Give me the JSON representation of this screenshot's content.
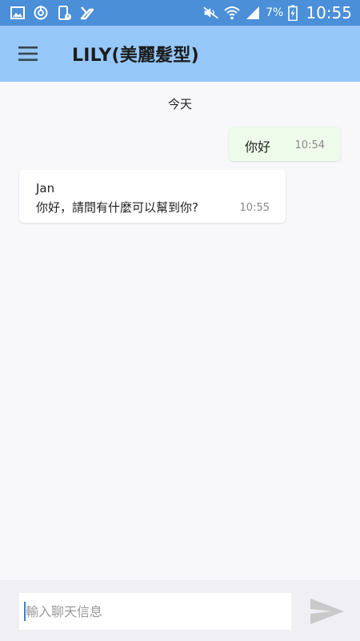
{
  "status_bar": {
    "battery": "7%",
    "time": "10:55",
    "icons": [
      "gallery-icon",
      "sync-icon",
      "device-alert-icon",
      "checkmark-app-icon",
      "mute-icon",
      "wifi-icon",
      "signal-icon",
      "battery-charging-icon"
    ]
  },
  "app_bar": {
    "menu_icon": "hamburger-menu-icon",
    "title": "LILY(美麗髮型)"
  },
  "chat": {
    "date_divider": "今天",
    "messages": [
      {
        "direction": "outgoing",
        "text": "你好",
        "time": "10:54"
      },
      {
        "direction": "incoming",
        "sender": "Jan",
        "text": "你好，請問有什麼可以幫到你?",
        "time": "10:55"
      }
    ]
  },
  "input": {
    "placeholder": "輸入聊天信息",
    "value": "",
    "send_icon": "send-icon"
  },
  "colors": {
    "status_bar": "#4a8fd8",
    "app_bar": "#95c7f8",
    "outgoing_bubble": "#eefaea",
    "incoming_bubble": "#ffffff",
    "background": "#f8f8fb",
    "input_bar": "#f0eff4"
  }
}
